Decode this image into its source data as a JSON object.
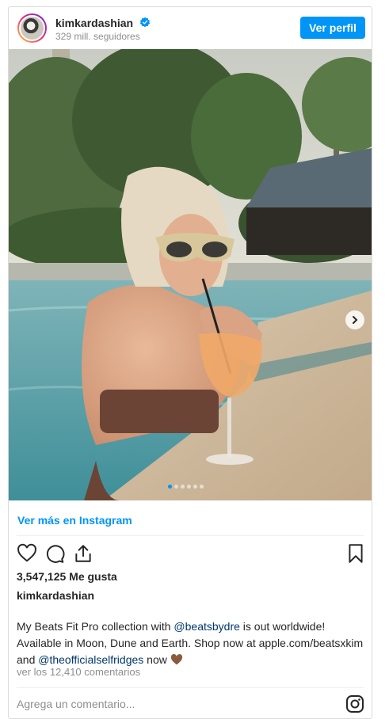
{
  "post": {
    "username": "kimkardashian",
    "followers": "329 mill. seguidores",
    "profile_button": "Ver perfil",
    "see_more": "Ver más en Instagram",
    "likes": "3,547,125 Me gusta",
    "caption_username": "kimkardashian",
    "caption_parts": {
      "p1": "My Beats Fit Pro collection with ",
      "m1": "@beatsbydre",
      "p2": " is out worldwide! Available in Moon, Dune and Earth. Shop now at apple.com/beatsxkim and ",
      "m2": "@theofficialselfridges",
      "p3": " now "
    },
    "comments_link": "ver los 12,410 comentarios",
    "comment_placeholder": "Agrega un comentario...",
    "carousel": {
      "total": 6,
      "active": 1
    }
  },
  "colors": {
    "accent": "#0095f6",
    "mention": "#00376b",
    "muted": "#8e8e8e"
  },
  "icons": [
    "verified-badge-icon",
    "heart-icon",
    "comment-icon",
    "share-icon",
    "bookmark-icon",
    "next-arrow-icon",
    "instagram-icon",
    "brown-heart-icon"
  ]
}
